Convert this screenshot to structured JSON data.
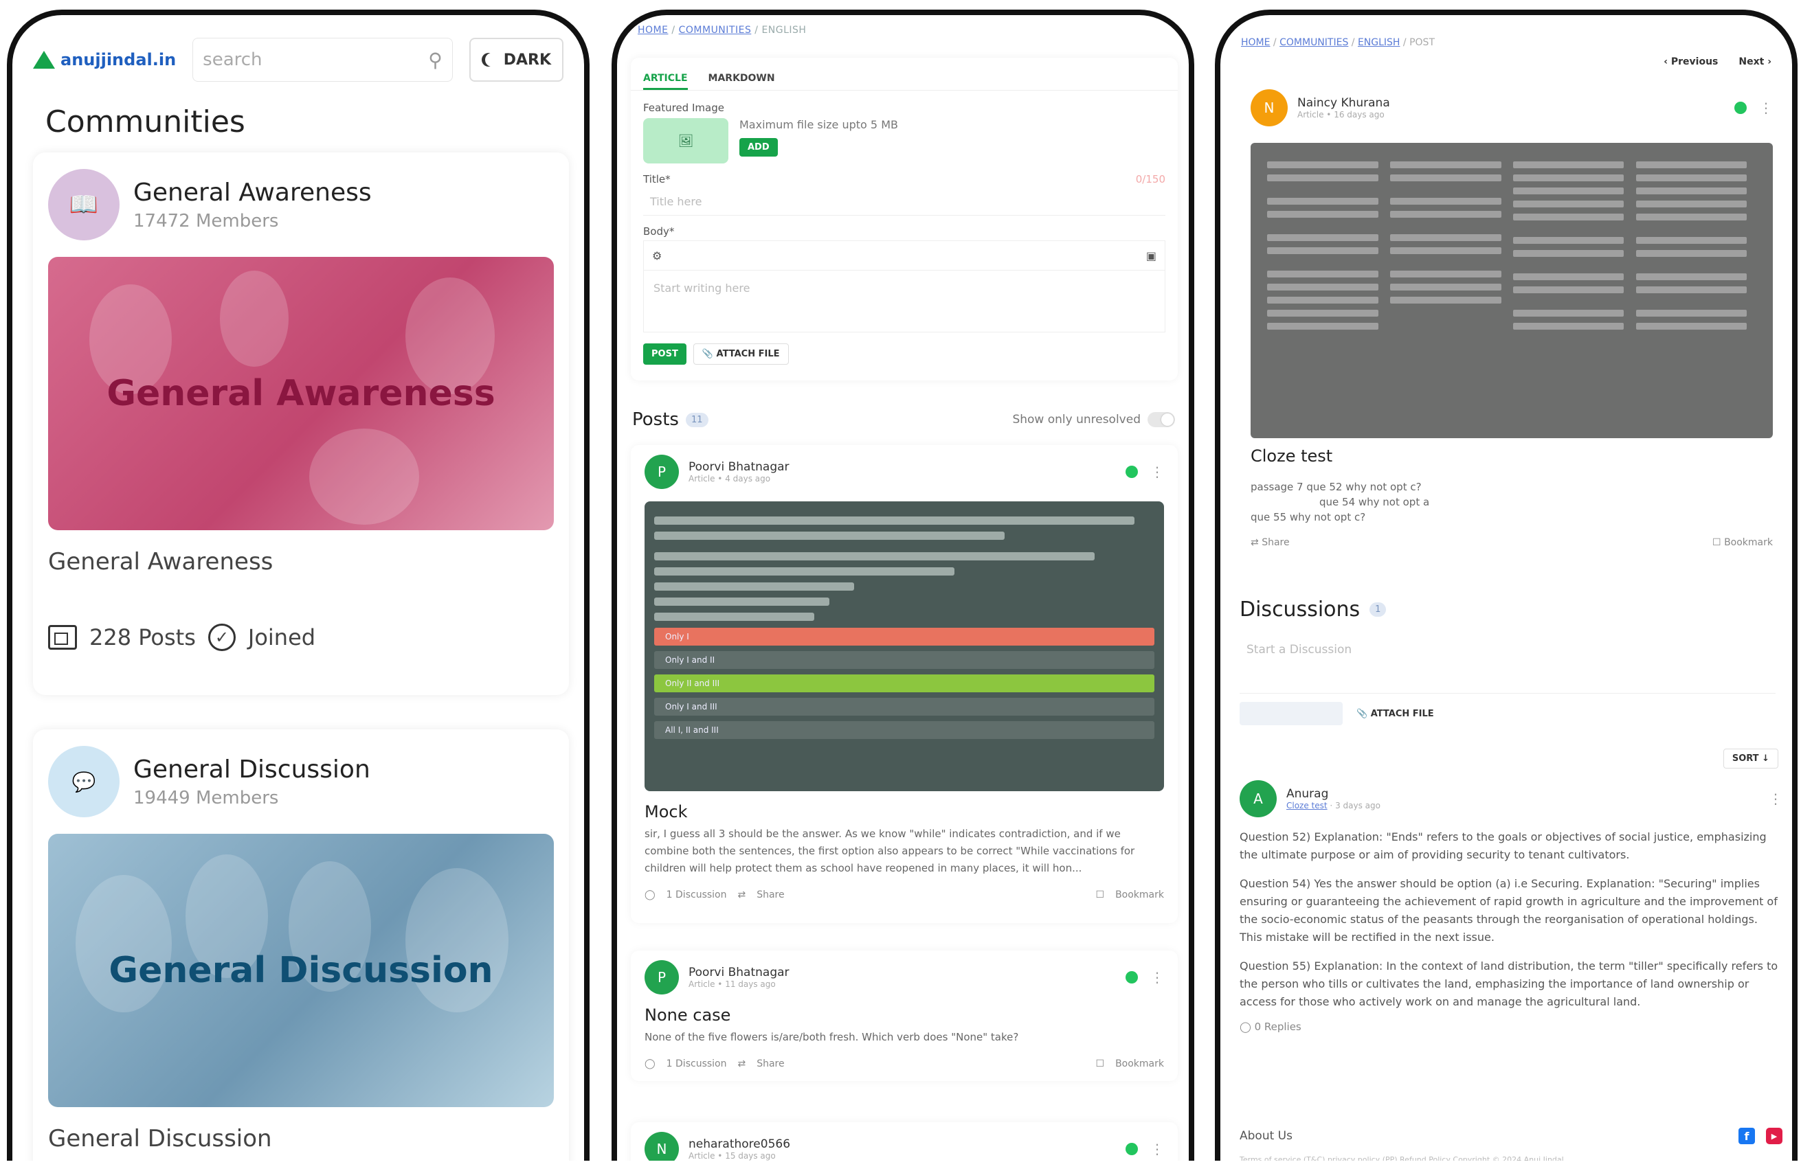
{
  "panel1": {
    "logo_text": "anujjindal.in",
    "search_placeholder": "search",
    "dark_label": "DARK",
    "title": "Communities",
    "channels": [
      {
        "name": "General Awareness",
        "members": "17472 Members",
        "banner_text": "General Awareness",
        "subtitle": "General Awareness",
        "posts": "228 Posts",
        "joined": "Joined"
      },
      {
        "name": "General Discussion",
        "members": "19449 Members",
        "banner_text": "General Discussion",
        "subtitle": "General Discussion"
      }
    ]
  },
  "panel2": {
    "breadcrumb": {
      "home": "HOME",
      "communities": "COMMUNITIES",
      "current": "ENGLISH"
    },
    "tabs": [
      "ARTICLE",
      "MARKDOWN"
    ],
    "featured_label": "Featured Image",
    "max_size": "Maximum file size upto 5 MB",
    "add_label": "ADD",
    "title_label": "Title*",
    "title_counter": "0/150",
    "title_placeholder": "Title here",
    "body_label": "Body*",
    "body_placeholder": "Start writing here",
    "post_label": "POST",
    "attach_label": "ATTACH FILE",
    "posts_title": "Posts",
    "posts_count": "11",
    "unresolved_label": "Show only unresolved",
    "posts": [
      {
        "avatar": "P",
        "author": "Poorvi Bhatnagar",
        "meta": "Article • 4 days ago",
        "title": "Mock",
        "body": "sir, I guess all 3 should be the answer. As we know \"while\" indicates contradiction, and if we combine both the sentences, the first option also appears to be correct \"While vaccinations for children will help protect them as school have reopened in many places, it will hon...",
        "discussion": "1 Discussion",
        "share": "Share",
        "bookmark": "Bookmark"
      },
      {
        "avatar": "P",
        "author": "Poorvi Bhatnagar",
        "meta": "Article • 11 days ago",
        "title": "None case",
        "body": "None of the five flowers is/are/both fresh. Which verb does \"None\" take?",
        "discussion": "1 Discussion",
        "share": "Share",
        "bookmark": "Bookmark"
      },
      {
        "avatar": "N",
        "author": "neharathore0566",
        "meta": "Article • 15 days ago"
      }
    ],
    "mock_options": [
      "Only I",
      "Only I and II",
      "Only II and III",
      "Only I and III",
      "All I, II and III"
    ]
  },
  "panel3": {
    "breadcrumb": {
      "home": "HOME",
      "communities": "COMMUNITIES",
      "english": "ENGLISH",
      "current": "POST"
    },
    "previous": "Previous",
    "next": "Next",
    "author": {
      "avatar": "N",
      "name": "Naincy Khurana",
      "meta": "Article • 16 days ago"
    },
    "post_title": "Cloze test",
    "post_body": [
      "passage 7 que 52 why not opt c?",
      "que 54 why not opt a",
      "que 55 why not opt c?"
    ],
    "share": "Share",
    "bookmark": "Bookmark",
    "discussions_title": "Discussions",
    "discussions_count": "1",
    "discussion_placeholder": "Start a Discussion",
    "attach_label": "ATTACH FILE",
    "sort_label": "SORT",
    "comment": {
      "avatar": "A",
      "author": "Anurag",
      "tag": "Cloze test",
      "time": "3 days ago",
      "paragraphs": [
        "Question 52) Explanation: \"Ends\" refers to the goals or objectives of social justice, emphasizing the ultimate purpose or aim of providing security to tenant cultivators.",
        "Question 54) Yes the answer should be option (a) i.e Securing. Explanation: \"Securing\" implies ensuring or guaranteeing the achievement of rapid growth in agriculture and the improvement of the socio-economic status of the peasants through the reorganisation of operational holdings. This mistake will be rectified in the next issue.",
        "Question 55) Explanation: In the context of land distribution, the term \"tiller\" specifically refers to the person who tills or cultivates the land, emphasizing the importance of land ownership or access for those who actively work on and manage the agricultural land."
      ],
      "replies": "0 Replies"
    },
    "about": "About Us",
    "copyright": "Terms of service (T&C)    privacy policy (PP)    Refund Policy    Copyright © 2024 Anuj Jindal"
  },
  "colors": {
    "accent_green": "#16a34a",
    "link_blue": "#5b7cd6",
    "banner_pink": "#d9587f",
    "banner_blue": "#8fb3c9"
  }
}
